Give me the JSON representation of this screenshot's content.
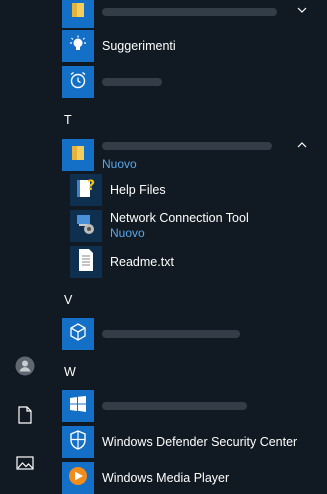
{
  "rail": {
    "items": [
      {
        "name": "user-account-icon"
      },
      {
        "name": "documents-icon"
      },
      {
        "name": "pictures-icon"
      }
    ]
  },
  "apps": {
    "top_folder": {
      "label": "",
      "icon": "folder-icon"
    },
    "suggerimenti": {
      "label": "Suggerimenti",
      "icon": "lightbulb-icon"
    },
    "alarms": {
      "label": "",
      "icon": "alarm-clock-icon"
    },
    "section_t": "T",
    "t_folder": {
      "label": "",
      "badge": "Nuovo",
      "icon": "folder-icon",
      "expanded": true
    },
    "help_files": {
      "label": "Help Files",
      "icon": "help-file-icon"
    },
    "network_tool": {
      "label": "Network Connection Tool",
      "badge": "Nuovo",
      "icon": "network-tool-icon"
    },
    "readme": {
      "label": "Readme.txt",
      "icon": "text-file-icon"
    },
    "section_v": "V",
    "v_app": {
      "label": "",
      "icon": "cube-icon"
    },
    "section_w": "W",
    "w_app": {
      "label": "",
      "icon": "windows-logo-icon"
    },
    "defender": {
      "label": "Windows Defender Security Center",
      "icon": "shield-icon"
    },
    "media_player": {
      "label": "Windows Media Player",
      "icon": "media-player-icon"
    }
  },
  "colors": {
    "background": "#111a22",
    "tile": "#1470c6",
    "badge": "#5aa7e8"
  }
}
